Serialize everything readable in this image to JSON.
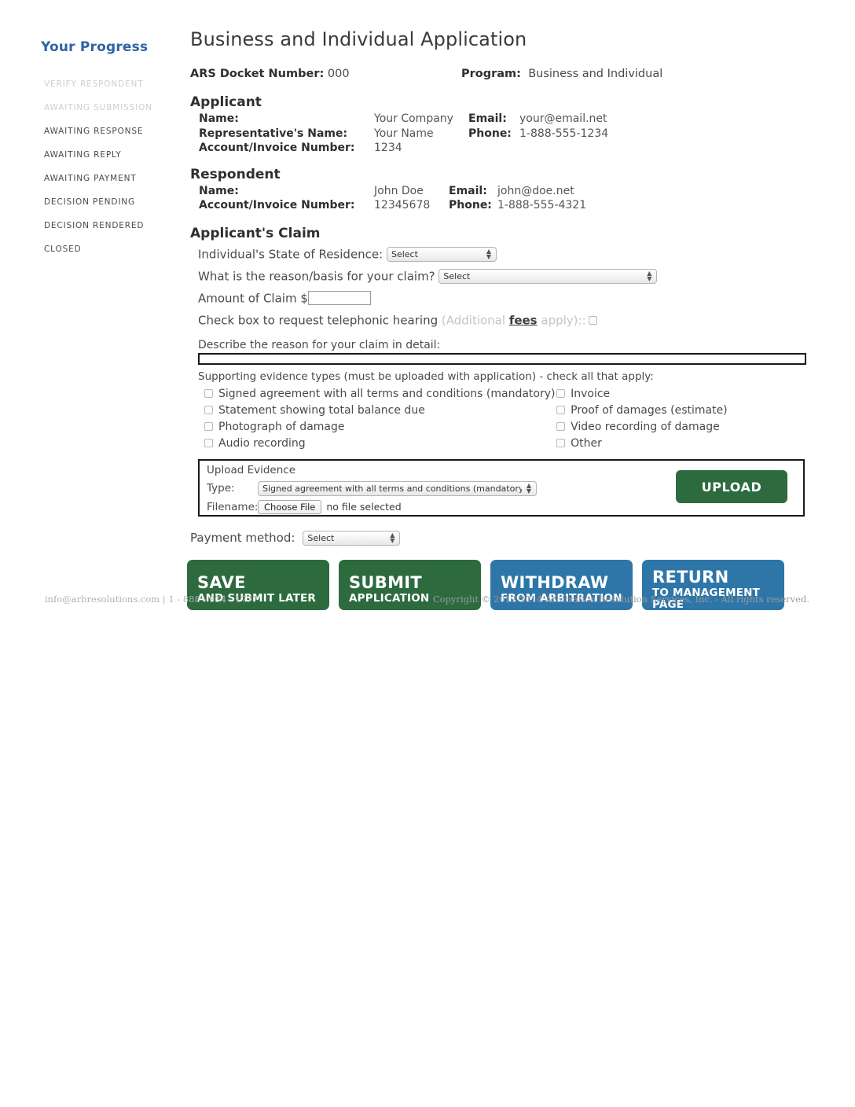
{
  "sidebar": {
    "title": "Your Progress",
    "steps": [
      {
        "label": "VERIFY RESPONDENT",
        "state": "done"
      },
      {
        "label": "AWAITING SUBMISSION",
        "state": "done"
      },
      {
        "label": "AWAITING RESPONSE",
        "state": "active"
      },
      {
        "label": "AWAITING REPLY",
        "state": "active"
      },
      {
        "label": "AWAITING PAYMENT",
        "state": "active"
      },
      {
        "label": "DECISION PENDING",
        "state": "active"
      },
      {
        "label": "DECISION RENDERED",
        "state": "active"
      },
      {
        "label": "CLOSED",
        "state": "active"
      }
    ]
  },
  "header": {
    "title": "Business and Individual Application",
    "docket_label": "ARS Docket Number:",
    "docket_value": "000",
    "program_label": "Program:",
    "program_value": "Business and Individual"
  },
  "applicant": {
    "heading": "Applicant",
    "name_label": "Name:",
    "name_value": "Your Company",
    "email_label": "Email:",
    "email_value": "your@email.net",
    "rep_label": "Representative's Name:",
    "rep_value": "Your Name",
    "phone_label": "Phone:",
    "phone_value": "1-888-555-1234",
    "account_label": "Account/Invoice Number:",
    "account_value": "1234"
  },
  "respondent": {
    "heading": "Respondent",
    "name_label": "Name:",
    "name_value": "John Doe",
    "email_label": "Email:",
    "email_value": "john@doe.net",
    "account_label": "Account/Invoice Number:",
    "account_value": "12345678",
    "phone_label": "Phone:",
    "phone_value": "1-888-555-4321"
  },
  "claim": {
    "heading": "Applicant's Claim",
    "state_label": "Individual's State of Residence:",
    "state_value": "Select",
    "reason_label": "What is the reason/basis for your claim?",
    "reason_value": "Select",
    "amount_label": "Amount of Claim",
    "amount_currency": "$",
    "amount_value": "",
    "telephonic_label": "Check box to request telephonic hearing",
    "telephonic_note_pre": "(Additional ",
    "telephonic_note_link": "fees",
    "telephonic_note_post": " apply)::",
    "describe_label": "Describe the reason for your claim in detail:",
    "describe_value": ""
  },
  "evidence": {
    "note": "Supporting evidence types (must be uploaded with application) - check all that apply:",
    "left": [
      "Signed agreement with all terms and conditions (mandatory)",
      "Statement showing total balance due",
      "Photograph of damage",
      "Audio recording"
    ],
    "right": [
      "Invoice",
      "Proof of damages (estimate)",
      "Video recording of damage",
      "Other"
    ]
  },
  "upload": {
    "title": "Upload Evidence",
    "type_label": "Type:",
    "type_value": "Signed agreement with all terms and conditions (mandatory)",
    "filename_label": "Filename:",
    "choose_file_label": "Choose File",
    "no_file_text": "no file selected",
    "button_label": "UPLOAD"
  },
  "payment": {
    "label": "Payment method:",
    "value": "Select"
  },
  "actions": [
    {
      "line1": "SAVE",
      "line2": "AND SUBMIT LATER",
      "color": "green"
    },
    {
      "line1": "SUBMIT",
      "line2": "APPLICATION",
      "color": "green"
    },
    {
      "line1": "WITHDRAW",
      "line2": "FROM ARBITRATION",
      "color": "blue"
    },
    {
      "line1": "RETURN",
      "line2": "TO MANAGEMENT PAGE",
      "color": "blue"
    }
  ],
  "footer": {
    "contact": "info@arbresolutions.com  |  1 - 888 - 934 - 1777",
    "copyright": "Copyright © 2012-2014 Arbitration Resolution Services, Inc. - All rights reserved."
  },
  "colors": {
    "accent_blue": "#2e63a6",
    "button_green": "#2d6b3f",
    "button_blue": "#2e76a8"
  }
}
